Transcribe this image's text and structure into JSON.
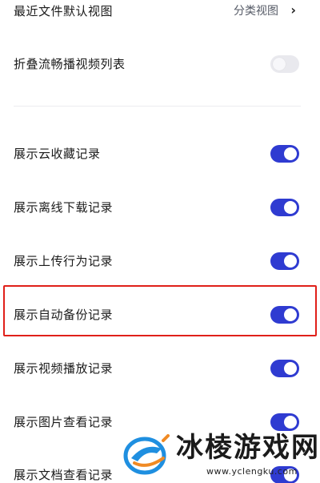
{
  "settings": {
    "recent_files": {
      "label": "最近文件默认视图",
      "value": "分类视图",
      "chevron": "›"
    },
    "fold_video_list": {
      "label": "折叠流畅播视频列表",
      "enabled": false
    },
    "toggles": [
      {
        "label": "展示云收藏记录",
        "enabled": true
      },
      {
        "label": "展示离线下载记录",
        "enabled": true
      },
      {
        "label": "展示上传行为记录",
        "enabled": true
      },
      {
        "label": "展示自动备份记录",
        "enabled": true,
        "highlighted": true
      },
      {
        "label": "展示视频播放记录",
        "enabled": true
      },
      {
        "label": "展示图片查看记录",
        "enabled": true
      },
      {
        "label": "展示文档查看记录",
        "enabled": true
      }
    ]
  },
  "colors": {
    "toggle_on": "#2f3bd1",
    "toggle_off": "#e9e9ee",
    "highlight_border": "#e0201a",
    "logo_blue": "#1f8fe0",
    "logo_orange": "#f08a24"
  },
  "watermark": {
    "title": "冰棱游戏网",
    "url": "www.yclengku.com",
    "logo_icon": "ice-logo-icon"
  }
}
